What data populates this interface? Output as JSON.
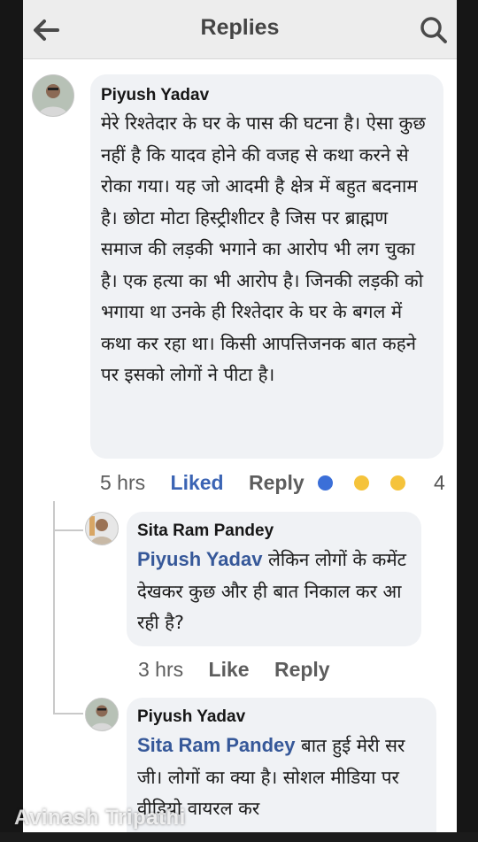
{
  "header": {
    "title": "Replies",
    "back_icon": "back-arrow-icon",
    "search_icon": "search-icon"
  },
  "comments": [
    {
      "author": "Piyush Yadav",
      "text": "मेरे रिश्तेदार के घर के पास की घटना है। ऐसा कुछ नहीं है कि यादव होने की वजह से कथा करने से रोका गया। यह जो आदमी है क्षेत्र में बहुत बदनाम है। छोटा मोटा हिस्ट्रीशीटर है जिस पर ब्राह्मण समाज की लड़की भगाने का आरोप भी लग चुका है। एक हत्या का भी आरोप है। जिनकी लड़की को भगाया था उनके ही रिश्तेदार के घर के बगल में कथा कर रहा था। किसी आपत्तिजनक बात कहने पर इसको लोगों ने पीटा है।",
      "time": "5 hrs",
      "like_label": "Liked",
      "reply_label": "Reply",
      "reactions": [
        "like",
        "wow",
        "haha"
      ],
      "reaction_count": "4"
    },
    {
      "author": "Sita Ram Pandey",
      "mention": "Piyush Yadav",
      "text": " लेकिन लोगों के कमेंट देखकर कुछ और ही बात निकाल कर आ रही है?",
      "time": "3 hrs",
      "like_label": "Like",
      "reply_label": "Reply"
    },
    {
      "author": "Piyush Yadav",
      "mention": "Sita Ram Pandey",
      "text": " बात हुई मेरी सर जी। लोगों का क्या है। सोशल मीडिया पर वीडियो वायरल कर"
    }
  ],
  "watermark": "Avinash Tripathi",
  "colors": {
    "mention": "#365899",
    "liked": "#3b64b4",
    "bubble": "#f0f2f5",
    "header": "#ededed"
  }
}
